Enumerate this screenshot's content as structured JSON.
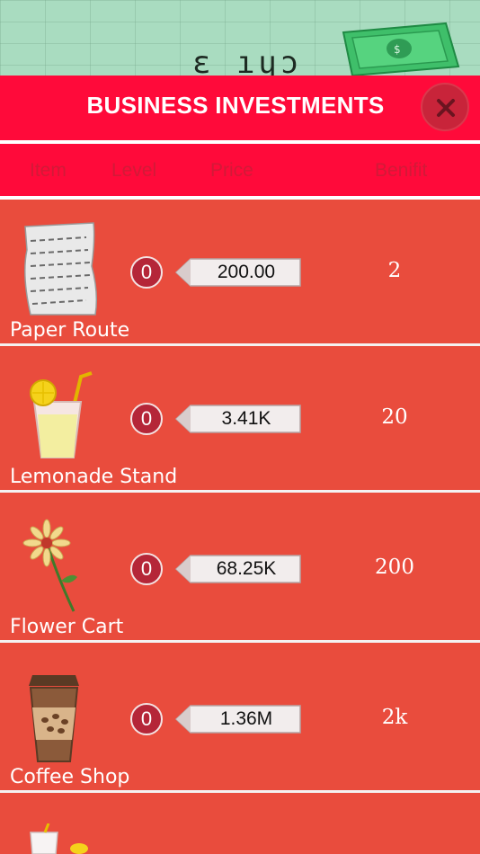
{
  "backdrop": {
    "lcd_text": "ԑ ıɥɔ"
  },
  "header": {
    "title": "BUSINESS INVESTMENTS"
  },
  "columns": {
    "item": "Item",
    "level": "Level",
    "price": "Price",
    "benefit": "Benifit"
  },
  "rows": [
    {
      "name": "Paper Route",
      "level": "0",
      "price": "200.00",
      "benefit": "2"
    },
    {
      "name": "Lemonade Stand",
      "level": "0",
      "price": "3.41K",
      "benefit": "20"
    },
    {
      "name": "Flower Cart",
      "level": "0",
      "price": "68.25K",
      "benefit": "200"
    },
    {
      "name": "Coffee Shop",
      "level": "0",
      "price": "1.36M",
      "benefit": "2k"
    }
  ],
  "colors": {
    "header": "#ff0a3a",
    "row_bg": "#e94c3d",
    "backdrop": "#a9dcc0"
  }
}
